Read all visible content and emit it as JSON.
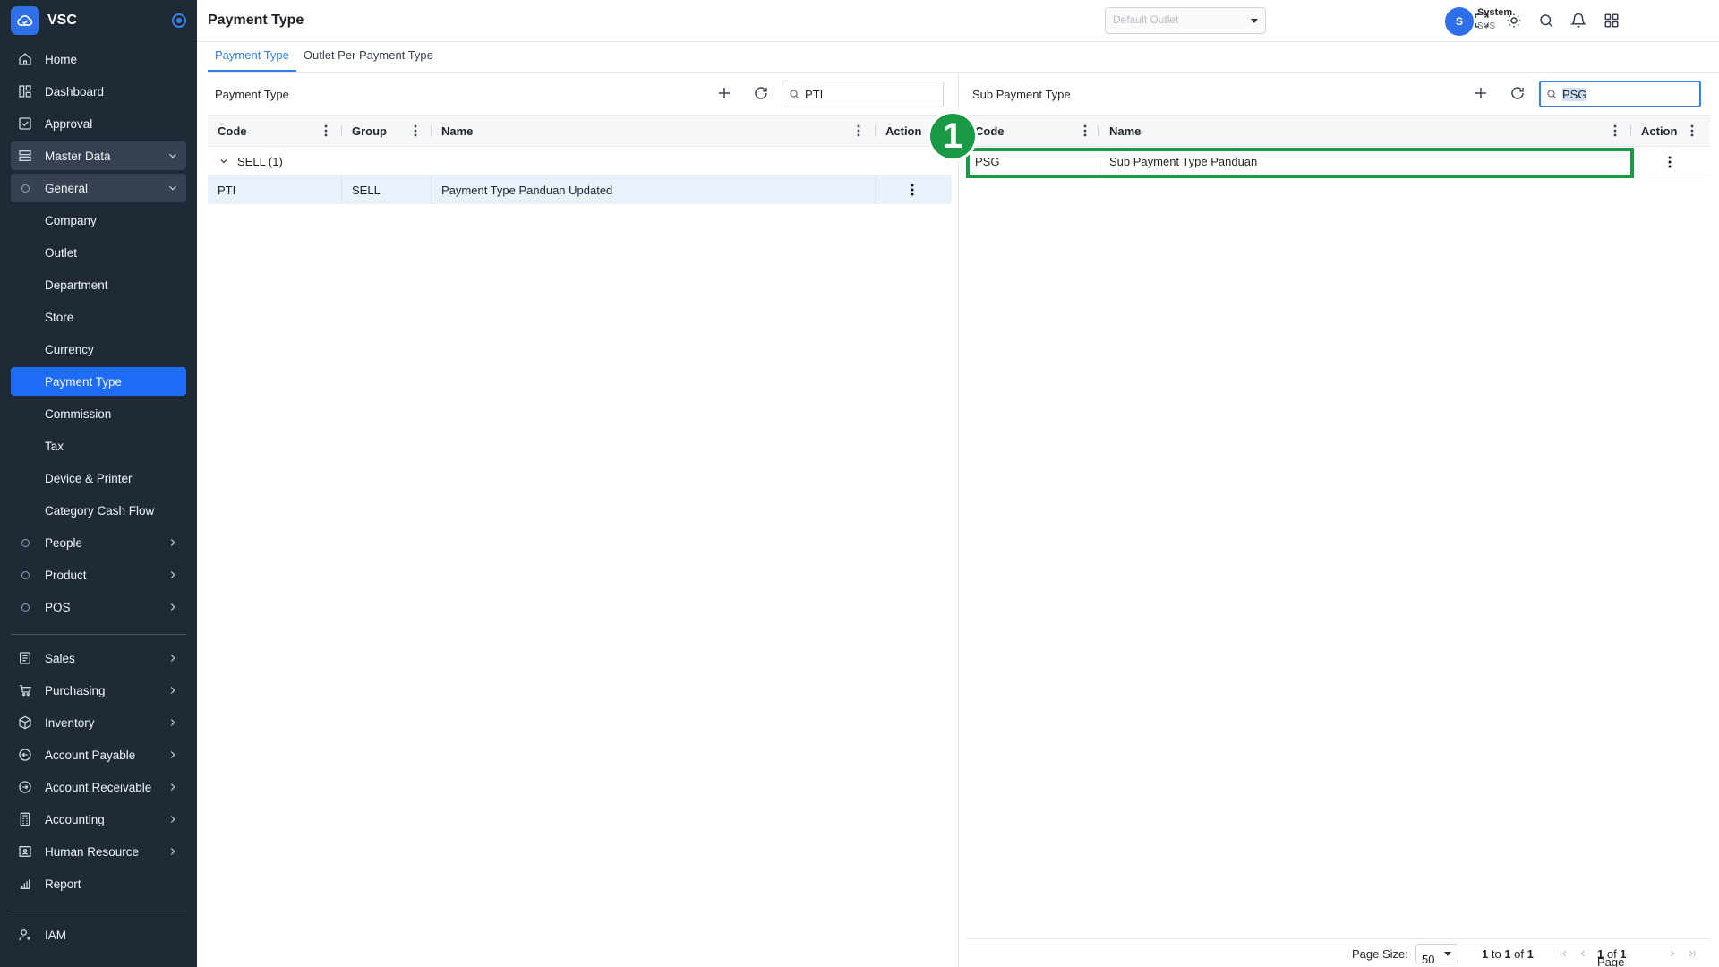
{
  "brand": {
    "name": "VSC"
  },
  "page_title": "Payment Type",
  "topbar": {
    "outlet_placeholder": "Default Outlet",
    "user_initial": "S",
    "user_name": "System",
    "user_role": "SYS"
  },
  "sidebar": {
    "top_items": [
      {
        "label": "Home",
        "icon": "home-icon"
      },
      {
        "label": "Dashboard",
        "icon": "dashboard-icon"
      },
      {
        "label": "Approval",
        "icon": "approval-icon"
      },
      {
        "label": "Master Data",
        "icon": "master-data-icon"
      },
      {
        "label": "General"
      }
    ],
    "general_items": [
      "Company",
      "Outlet",
      "Department",
      "Store",
      "Currency",
      "Payment Type",
      "Commission",
      "Tax",
      "Device & Printer",
      "Category Cash Flow"
    ],
    "master_groups": [
      "People",
      "Product",
      "POS"
    ],
    "modules": [
      {
        "label": "Sales",
        "icon": "sales-icon"
      },
      {
        "label": "Purchasing",
        "icon": "cart-icon"
      },
      {
        "label": "Inventory",
        "icon": "box-icon"
      },
      {
        "label": "Account Payable",
        "icon": "arrow-left-circle-icon"
      },
      {
        "label": "Account Receivable",
        "icon": "arrow-right-circle-icon"
      },
      {
        "label": "Accounting",
        "icon": "calculator-icon"
      },
      {
        "label": "Human Resource",
        "icon": "id-card-icon"
      },
      {
        "label": "Report",
        "icon": "bar-chart-icon"
      }
    ],
    "iam": "IAM"
  },
  "tabs": [
    "Payment Type",
    "Outlet Per Payment Type"
  ],
  "left_panel": {
    "title": "Payment Type",
    "search_value": "PTI",
    "columns": [
      "Code",
      "Group",
      "Name",
      "Action"
    ],
    "group_label": "SELL (1)",
    "rows": [
      {
        "code": "PTI",
        "group": "SELL",
        "name": "Payment Type Panduan Updated"
      }
    ]
  },
  "right_panel": {
    "title": "Sub Payment Type",
    "search_value": "PSG",
    "columns": [
      "Code",
      "Name",
      "Action"
    ],
    "rows": [
      {
        "code": "PSG",
        "name": "Sub Payment Type Panduan"
      }
    ]
  },
  "annotation": {
    "step": "1",
    "color": "#1a9a45"
  },
  "footer": {
    "page_size_label": "Page Size:",
    "page_size": "50",
    "range_from": "1",
    "range_to": "1",
    "total": "1",
    "page_word": "Page",
    "page_current": "1",
    "page_total": "1"
  },
  "colors": {
    "sidebar_bg": "#1f2a37",
    "accent": "#1f6cf6",
    "selected_row": "#e8f1fd"
  }
}
